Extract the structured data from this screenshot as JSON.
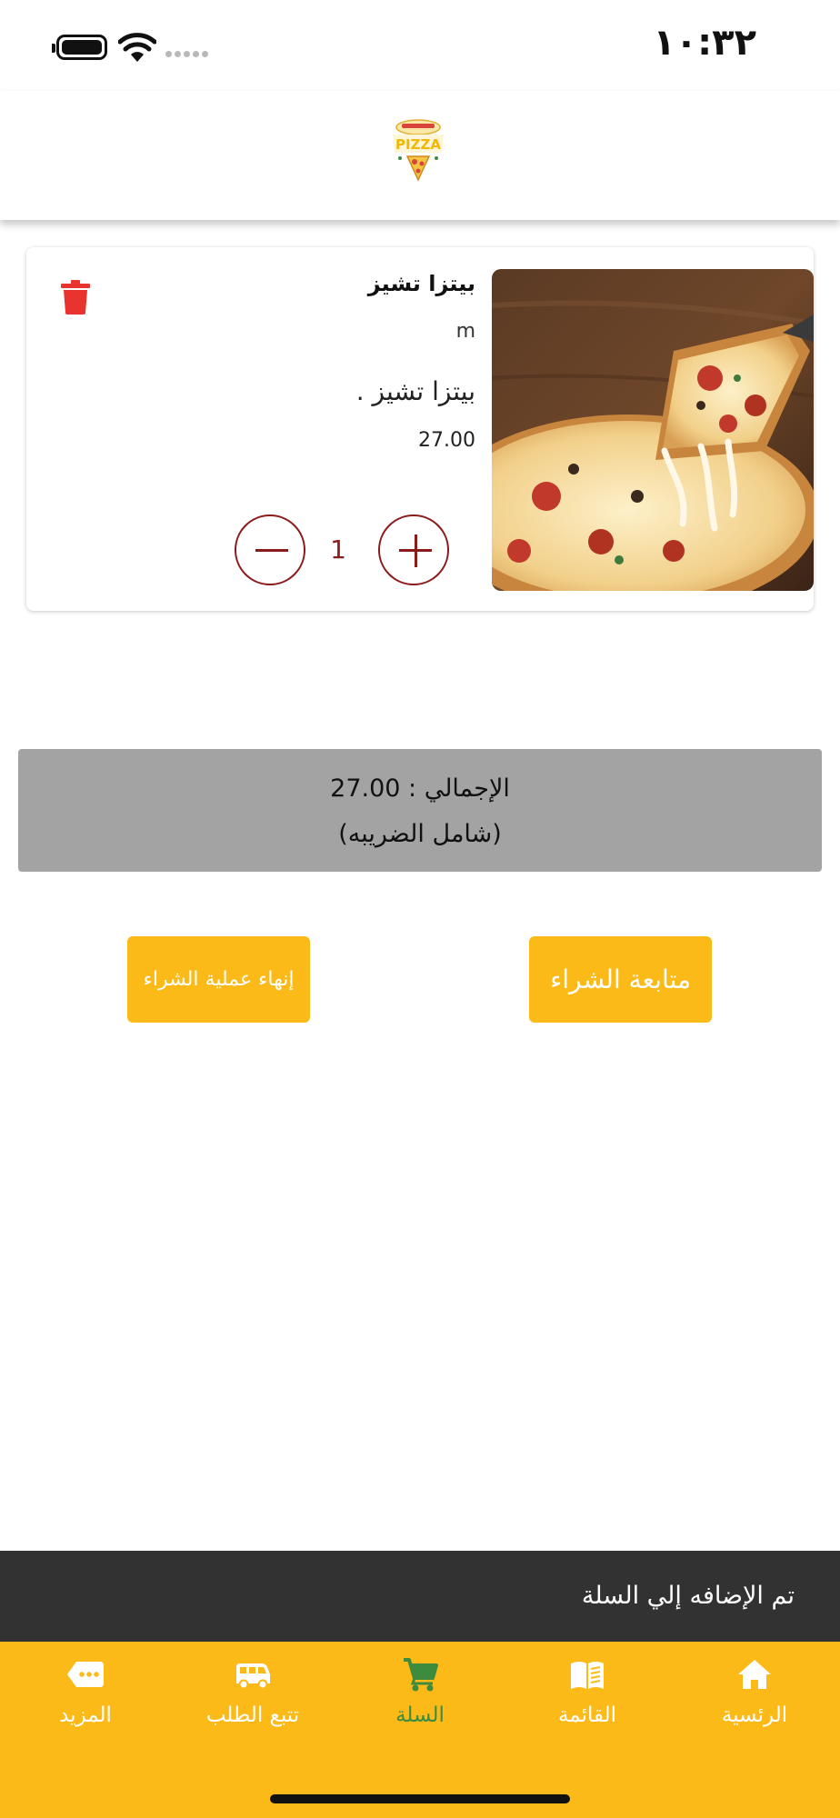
{
  "status_bar": {
    "time": "١٠:٣٢"
  },
  "header": {
    "logo_text": "PIZZA"
  },
  "cart": {
    "items": [
      {
        "name": "بيتزا تشيز",
        "size": "m",
        "description": "بيتزا تشيز .",
        "price": "27.00",
        "quantity": "1"
      }
    ]
  },
  "summary": {
    "total": "الإجمالي : 27.00",
    "tax_note": "(شامل الضريبه)"
  },
  "actions": {
    "continue_label": "متابعة الشراء",
    "checkout_label": "إنهاء عملية الشراء"
  },
  "snackbar": {
    "message": "تم الإضافه إلي السلة"
  },
  "bottom_nav": {
    "items": [
      {
        "label": "الرئسية",
        "icon": "home-icon"
      },
      {
        "label": "القائمة",
        "icon": "menu-book-icon"
      },
      {
        "label": "السلة",
        "icon": "cart-icon",
        "active": true
      },
      {
        "label": "تتبع الطلب",
        "icon": "delivery-van-icon"
      },
      {
        "label": "المزيد",
        "icon": "more-tag-icon"
      }
    ]
  },
  "colors": {
    "accent": "#fbba17",
    "active_nav": "#3d8b3d",
    "qty_control": "#8b1a1a",
    "delete": "#e8332e",
    "snackbar": "#323232"
  }
}
